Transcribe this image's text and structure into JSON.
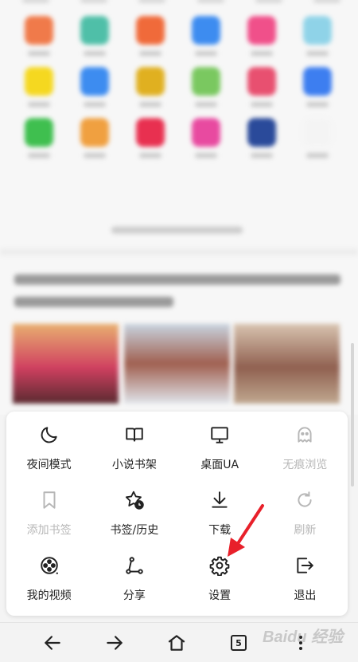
{
  "menu": {
    "items": [
      {
        "label": "夜间模式",
        "icon": "moon-icon",
        "enabled": true
      },
      {
        "label": "小说书架",
        "icon": "book-icon",
        "enabled": true
      },
      {
        "label": "桌面UA",
        "icon": "monitor-icon",
        "enabled": true
      },
      {
        "label": "无痕浏览",
        "icon": "ghost-icon",
        "enabled": false
      },
      {
        "label": "添加书签",
        "icon": "bookmark-icon",
        "enabled": false
      },
      {
        "label": "书签/历史",
        "icon": "star-clock-icon",
        "enabled": true
      },
      {
        "label": "下载",
        "icon": "download-icon",
        "enabled": true
      },
      {
        "label": "刷新",
        "icon": "refresh-icon",
        "enabled": false
      },
      {
        "label": "我的视频",
        "icon": "film-reel-icon",
        "enabled": true
      },
      {
        "label": "分享",
        "icon": "share-icon",
        "enabled": true
      },
      {
        "label": "设置",
        "icon": "gear-icon",
        "enabled": true
      },
      {
        "label": "退出",
        "icon": "exit-icon",
        "enabled": true
      }
    ]
  },
  "bottom_nav": {
    "tab_count": "5"
  },
  "colors": {
    "text": "#222222",
    "disabled": "#b7b7b7",
    "annotation_arrow": "#e8202a"
  },
  "watermark": "Baidu 经验"
}
